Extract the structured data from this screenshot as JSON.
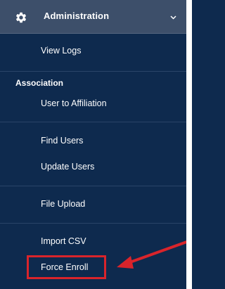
{
  "menu": {
    "header": {
      "icon": "gear-icon",
      "title": "Administration",
      "chevron": "chevron-down-icon"
    },
    "items": {
      "view_logs": "View Logs",
      "association_section": "Association",
      "user_to_affiliation": "User to Affiliation",
      "find_users": "Find Users",
      "update_users": "Update Users",
      "file_upload": "File Upload",
      "import_csv": "Import CSV",
      "force_enroll": "Force Enroll"
    }
  },
  "annotation": {
    "highlight_color": "#d9242b"
  },
  "colors": {
    "background": "#0e2a4e",
    "header": "#3d4f6a",
    "text": "#ffffff"
  }
}
